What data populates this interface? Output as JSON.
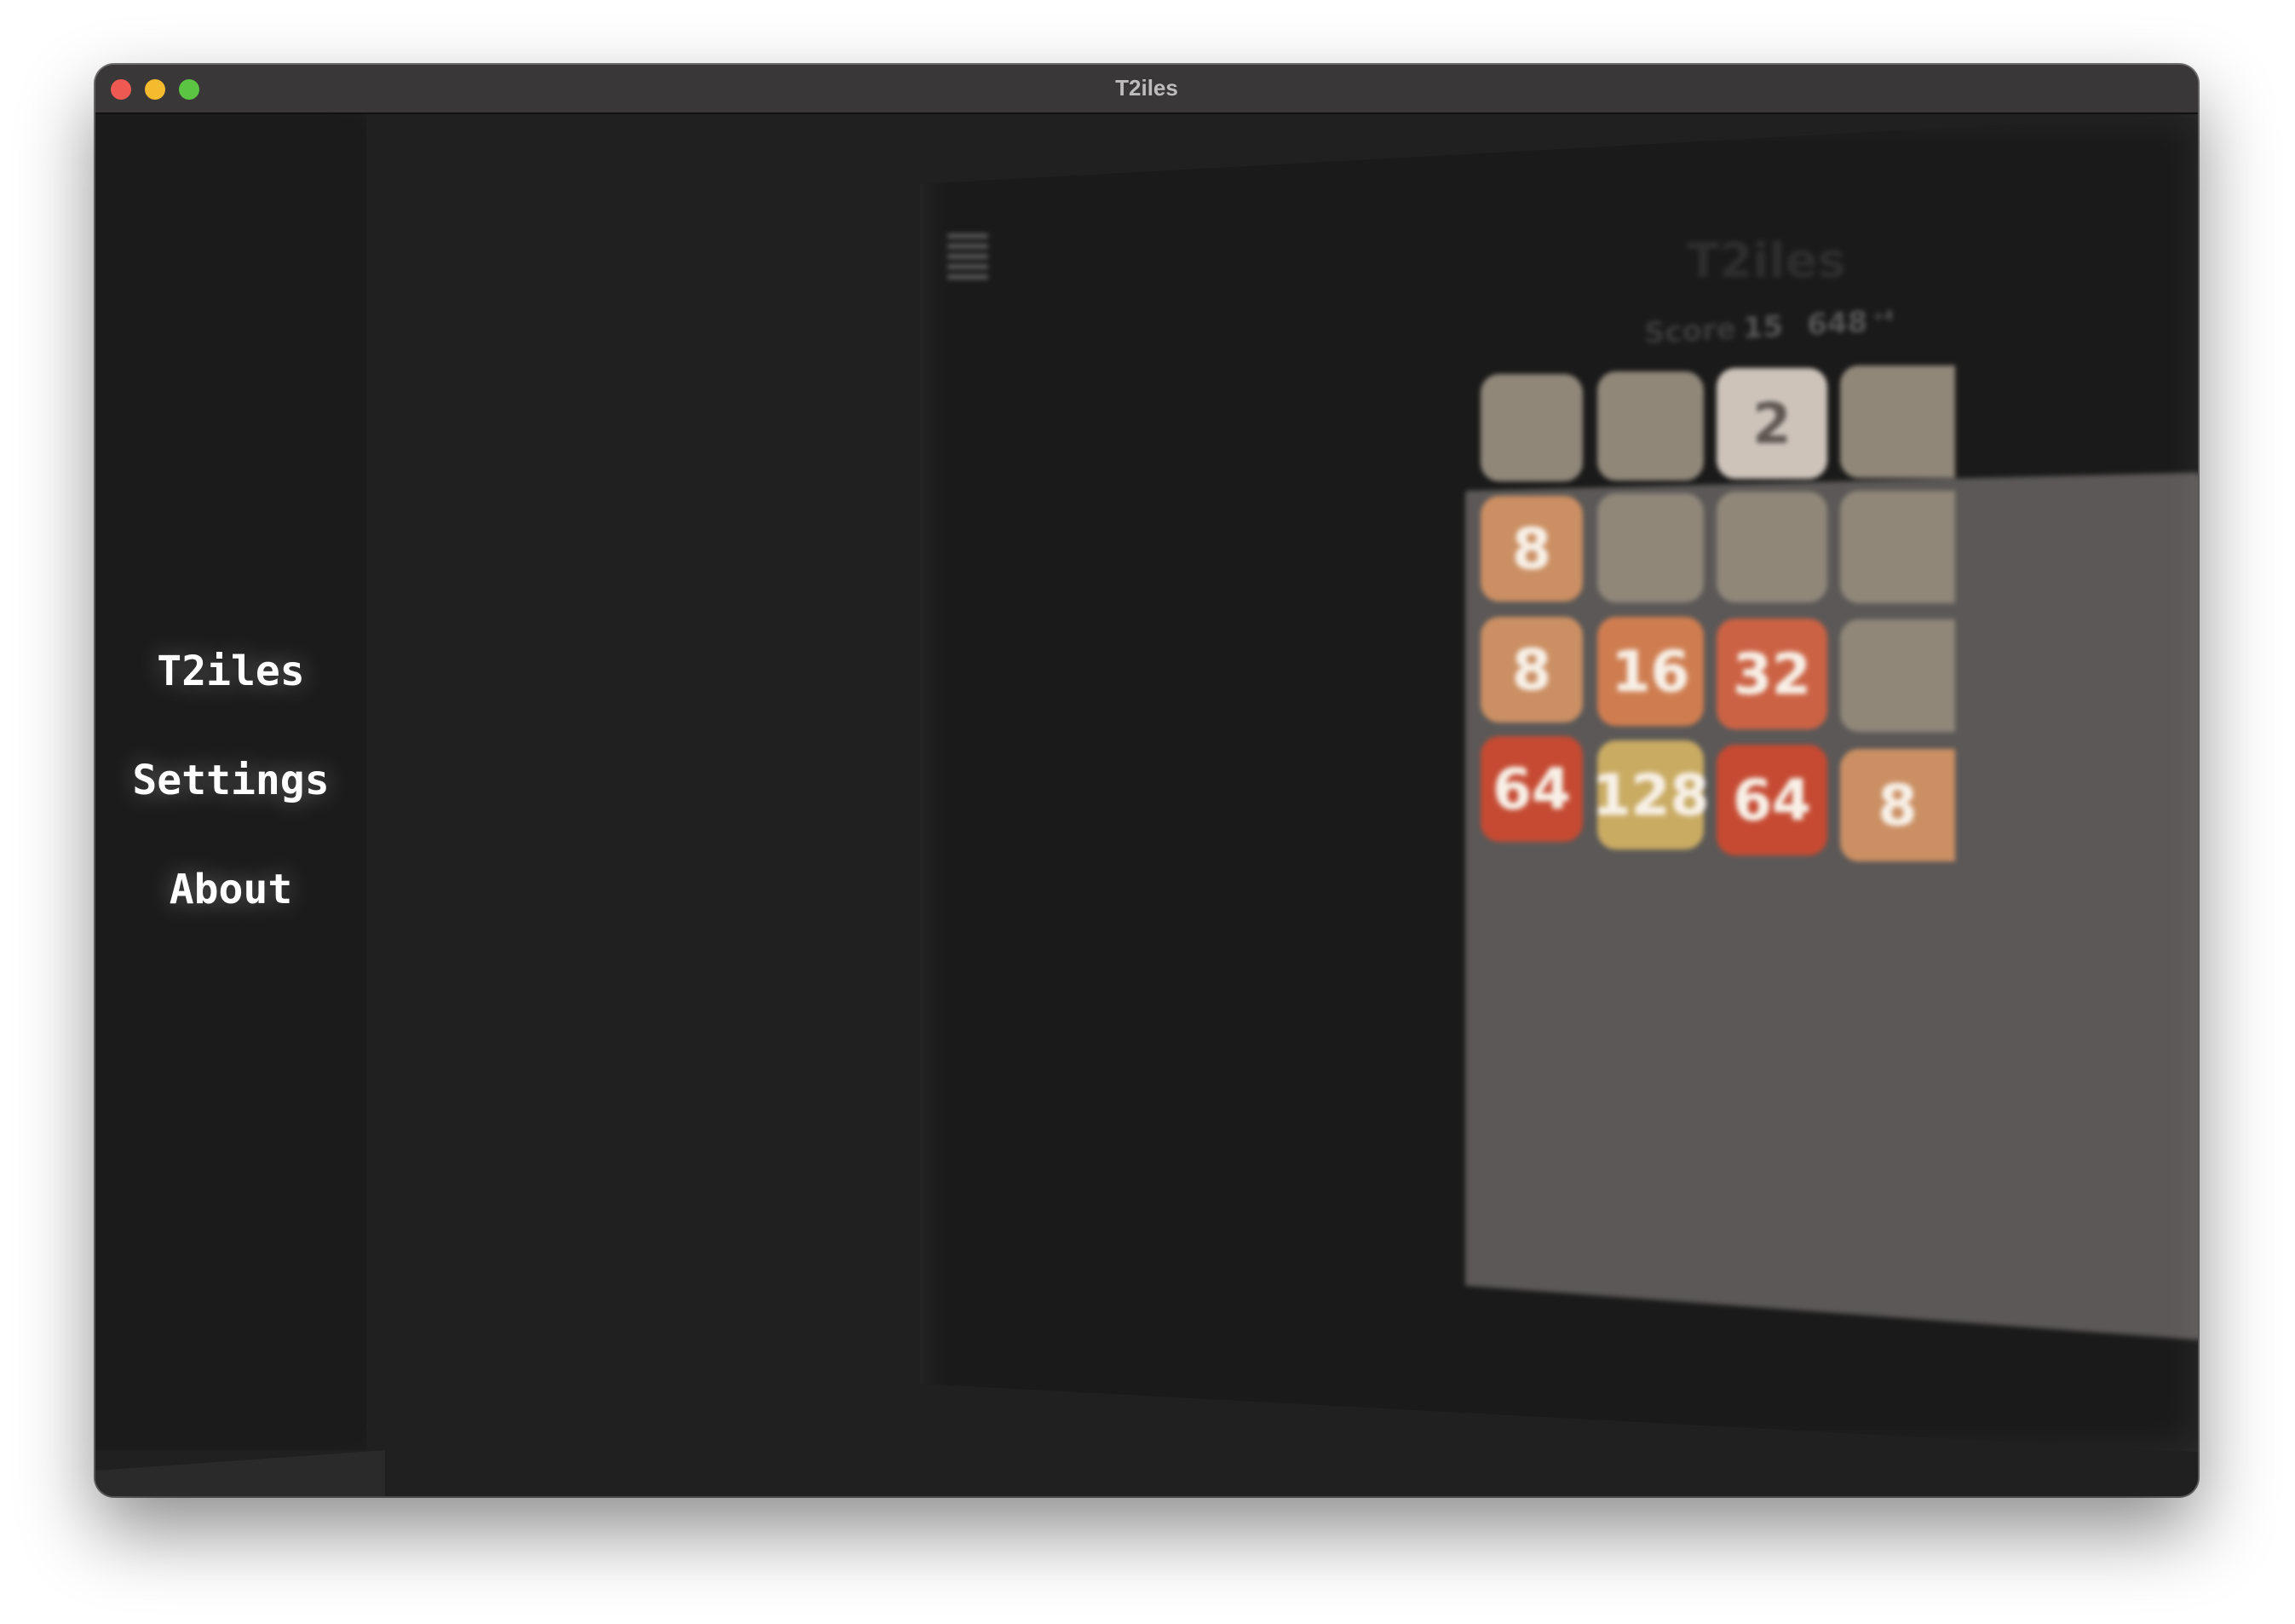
{
  "window": {
    "title": "T2iles"
  },
  "sidebar": {
    "items": [
      {
        "label": "T2iles"
      },
      {
        "label": "Settings"
      },
      {
        "label": "About"
      }
    ]
  },
  "game": {
    "title": "T2iles",
    "score_label": "Score",
    "score_value_1": "15",
    "score_value_2": "648",
    "score_sup": "+4",
    "board": [
      [
        "",
        "",
        "2",
        ""
      ],
      [
        "8",
        "",
        "",
        ""
      ],
      [
        "8",
        "16",
        "32",
        ""
      ],
      [
        "64",
        "128",
        "64",
        "8"
      ]
    ]
  },
  "colors": {
    "empty": "#908779",
    "t2": "#cdc3b9",
    "t8": "#cb8f63",
    "t16": "#cf7d50",
    "t32": "#cc6244",
    "t64": "#c64a32",
    "t128": "#c9ab62",
    "board": "#5b5857"
  }
}
